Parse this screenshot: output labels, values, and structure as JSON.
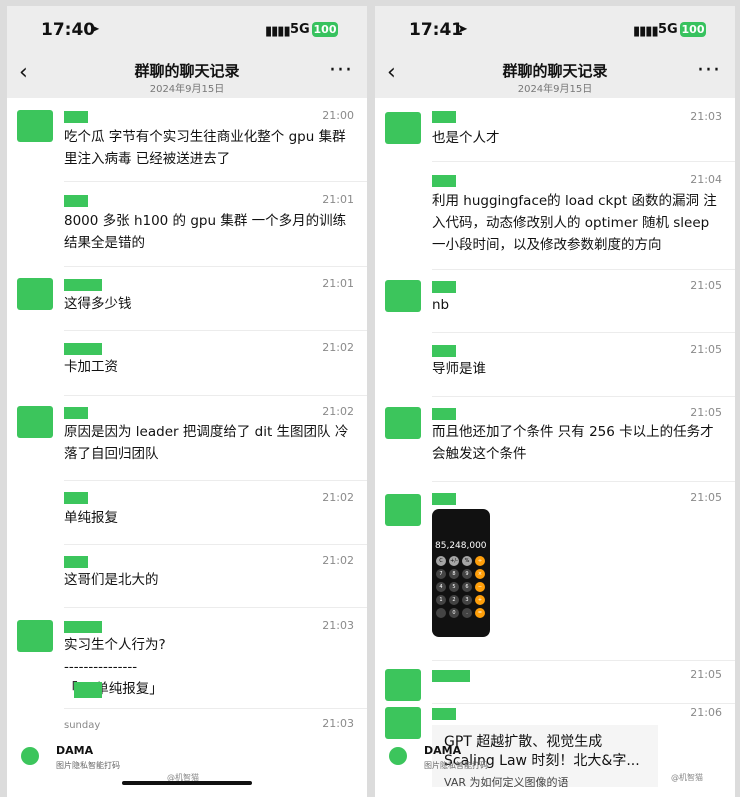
{
  "left": {
    "status": {
      "time": "17:40",
      "loc": "➤",
      "net": "▮▮▮▮",
      "g": "5G",
      "batt": "100"
    },
    "nav": {
      "back": "‹",
      "title": "群聊的聊天记录",
      "date": "2024年9月15日",
      "more": "···"
    },
    "messages": [
      {
        "time": "21:00",
        "text": "吃个瓜 字节有个实习生往商业化整个 gpu 集群里注入病毒 已经被送进去了"
      },
      {
        "time": "21:01",
        "text": "8000 多张 h100 的 gpu 集群 一个多月的训练结果全是错的"
      },
      {
        "time": "21:01",
        "text": "这得多少钱"
      },
      {
        "time": "21:02",
        "text": "卡加工资"
      },
      {
        "time": "21:02",
        "text": "原因是因为 leader 把调度给了 dit 生图团队 冷落了自回归团队"
      },
      {
        "time": "21:02",
        "text": "单纯报复"
      },
      {
        "time": "21:02",
        "text": "这哥们是北大的"
      },
      {
        "time": "21:03",
        "text": "实习生个人行为?",
        "divider": "---------------",
        "quote": "「       ：单纯报复」"
      },
      {
        "time": "21:03",
        "small": "sunday"
      }
    ],
    "watermark": {
      "brand": "DAMA",
      "sub": "图片隐私智能打码",
      "mark": "@机智猫"
    }
  },
  "right": {
    "status": {
      "time": "17:41",
      "loc": "➤",
      "net": "▮▮▮▮",
      "g": "5G",
      "batt": "100"
    },
    "nav": {
      "back": "‹",
      "title": "群聊的聊天记录",
      "date": "2024年9月15日",
      "more": "···"
    },
    "messages": [
      {
        "time": "21:03",
        "text": "也是个人才"
      },
      {
        "time": "21:04",
        "text": "利用 huggingface的 load ckpt 函数的漏洞 注入代码，动态修改别人的 optimer 随机 sleep 一小段时间，以及修改参数剃度的方向"
      },
      {
        "time": "21:05",
        "text": "nb"
      },
      {
        "time": "21:05",
        "text": "导师是谁"
      },
      {
        "time": "21:05",
        "text": "而且他还加了个条件 只有 256 卡以上的任务才会触发这个条件"
      },
      {
        "time": "21:05",
        "calc": "85,248,000"
      },
      {
        "time": "21:05"
      },
      {
        "time": "21:06",
        "link_title": "GPT 超越扩散、视觉生成 Scaling Law 时刻！北大&字...",
        "link_sub": "VAR 为如何定义图像的语"
      }
    ],
    "calc_keys": [
      "C",
      "+/-",
      "%",
      "÷",
      "7",
      "8",
      "9",
      "×",
      "4",
      "5",
      "6",
      "−",
      "1",
      "2",
      "3",
      "+",
      "",
      "0",
      ".",
      "="
    ],
    "watermark": {
      "brand": "DAMA",
      "sub": "图片隐私智能打码",
      "mark": "@机智猫"
    }
  }
}
